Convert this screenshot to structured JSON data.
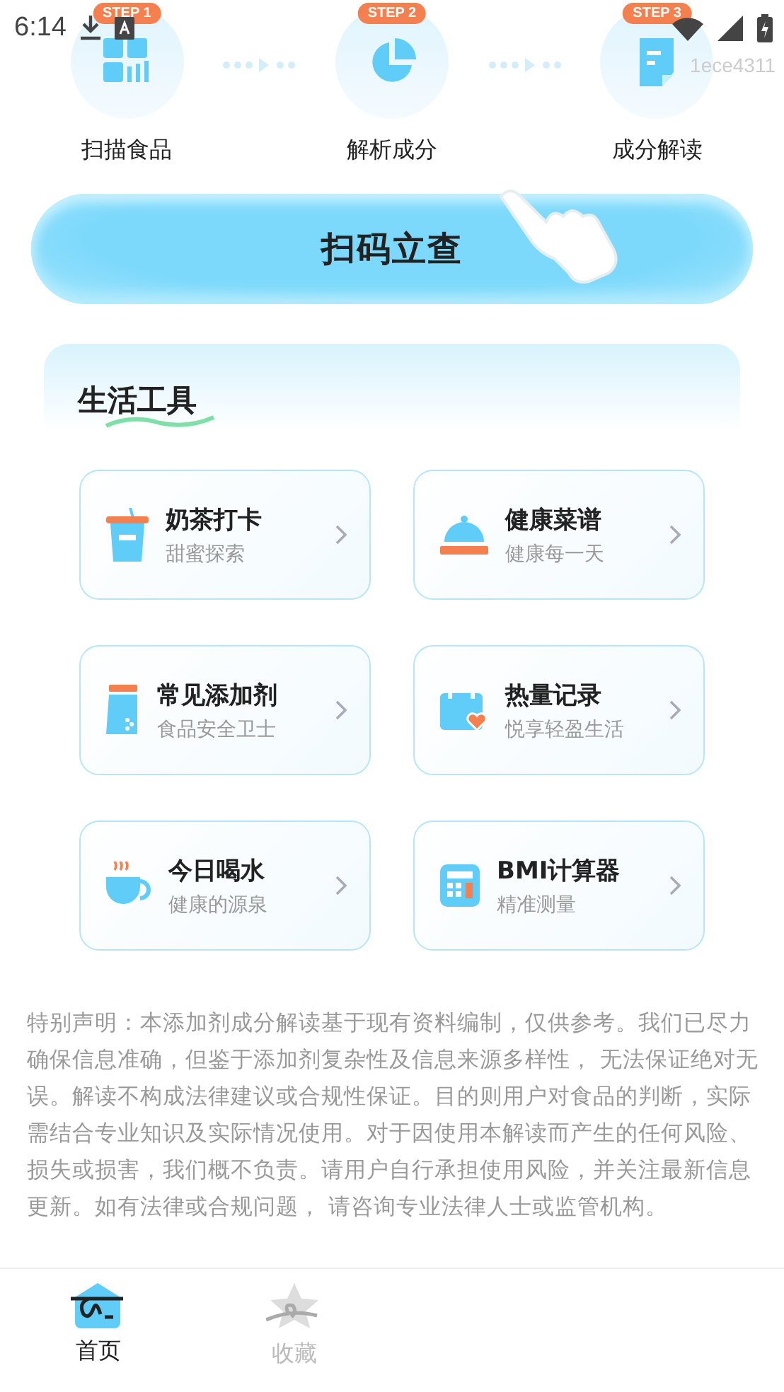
{
  "status_bar": {
    "time": "6:14",
    "device_tag": "1ece4311"
  },
  "steps": [
    {
      "badge": "STEP 1",
      "label": "扫描食品",
      "kind": "scan"
    },
    {
      "badge": "STEP 2",
      "label": "解析成分",
      "kind": "chart"
    },
    {
      "badge": "STEP 3",
      "label": "成分解读",
      "kind": "document"
    }
  ],
  "scan_button": {
    "label": "扫码立查"
  },
  "tools": {
    "title": "生活工具",
    "items": [
      {
        "title": "奶茶打卡",
        "subtitle": "甜蜜探索",
        "kind": "cup"
      },
      {
        "title": "健康菜谱",
        "subtitle": "健康每一天",
        "kind": "cloche"
      },
      {
        "title": "常见添加剂",
        "subtitle": "食品安全卫士",
        "kind": "jar"
      },
      {
        "title": "热量记录",
        "subtitle": "悦享轻盈生活",
        "kind": "calendar"
      },
      {
        "title": "今日喝水",
        "subtitle": "健康的源泉",
        "kind": "mug"
      },
      {
        "title": "BMI计算器",
        "subtitle": "精准测量",
        "kind": "calculator"
      }
    ]
  },
  "disclaimer": "特别声明：本添加剂成分解读基于现有资料编制，仅供参考。我们已尽力确保信息准确，但鉴于添加剂复杂性及信息来源多样性， 无法保证绝对无误。解读不构成法律建议或合规性保证。目的则用户对食品的判断，实际需结合专业知识及实际情况使用。对于因使用本解读而产生的任何风险、损失或损害，我们概不负责。请用户自行承担使用风险，并关注最新信息更新。如有法律或合规问题， 请咨询专业法律人士或监管机构。",
  "bottom_nav": [
    {
      "label": "首页",
      "kind": "home",
      "selected": true
    },
    {
      "label": "收藏",
      "kind": "star",
      "selected": false
    }
  ]
}
